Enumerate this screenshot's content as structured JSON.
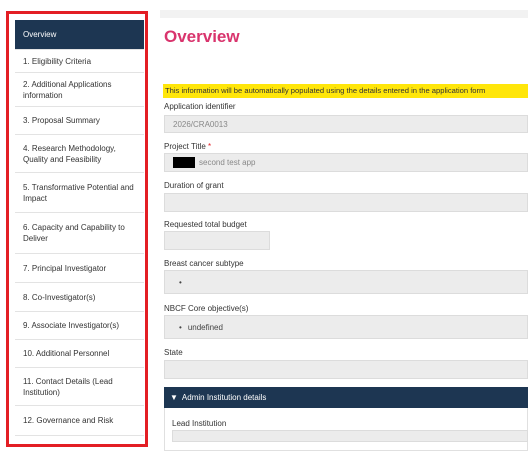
{
  "sidebar": {
    "items": [
      {
        "label": "Overview",
        "active": true
      },
      {
        "label": "1. Eligibility Criteria"
      },
      {
        "label": "2. Additional Applications information"
      },
      {
        "label": "3. Proposal Summary"
      },
      {
        "label": "4. Research Methodology, Quality and Feasibility"
      },
      {
        "label": "5. Transformative Potential and Impact"
      },
      {
        "label": "6. Capacity and Capability to Deliver"
      },
      {
        "label": "7. Principal Investigator"
      },
      {
        "label": "8. Co-Investigator(s)"
      },
      {
        "label": "9. Associate Investigator(s)"
      },
      {
        "label": "10. Additional Personnel"
      },
      {
        "label": "11. Contact Details (Lead Institution)"
      },
      {
        "label": "12. Governance and Risk"
      }
    ]
  },
  "main": {
    "title": "Overview",
    "notice": "This information will be automatically populated using the details entered in the application form",
    "fields": {
      "application_identifier": {
        "label": "Application identifier",
        "value": "2026/CRA0013"
      },
      "project_title": {
        "label": "Project Title",
        "required_mark": "*",
        "value": "second test app"
      },
      "duration_of_grant": {
        "label": "Duration of grant",
        "value": ""
      },
      "requested_total_budget": {
        "label": "Requested total budget",
        "value": ""
      },
      "breast_cancer_subtype": {
        "label": "Breast cancer subtype",
        "bullet": "•",
        "value": ""
      },
      "nbcf_core_objectives": {
        "label": "NBCF Core objective(s)",
        "bullet": "•",
        "value": "undefined"
      },
      "state": {
        "label": "State",
        "value": ""
      }
    },
    "admin_section": {
      "toggle_icon": "▼",
      "header": "Admin Institution details",
      "lead_institution_label": "Lead Institution"
    }
  },
  "colors": {
    "nav_active_bg": "#1d3652",
    "title": "#d9346d",
    "highlight": "#ffe60a",
    "sidebar_border": "#e31e24"
  }
}
